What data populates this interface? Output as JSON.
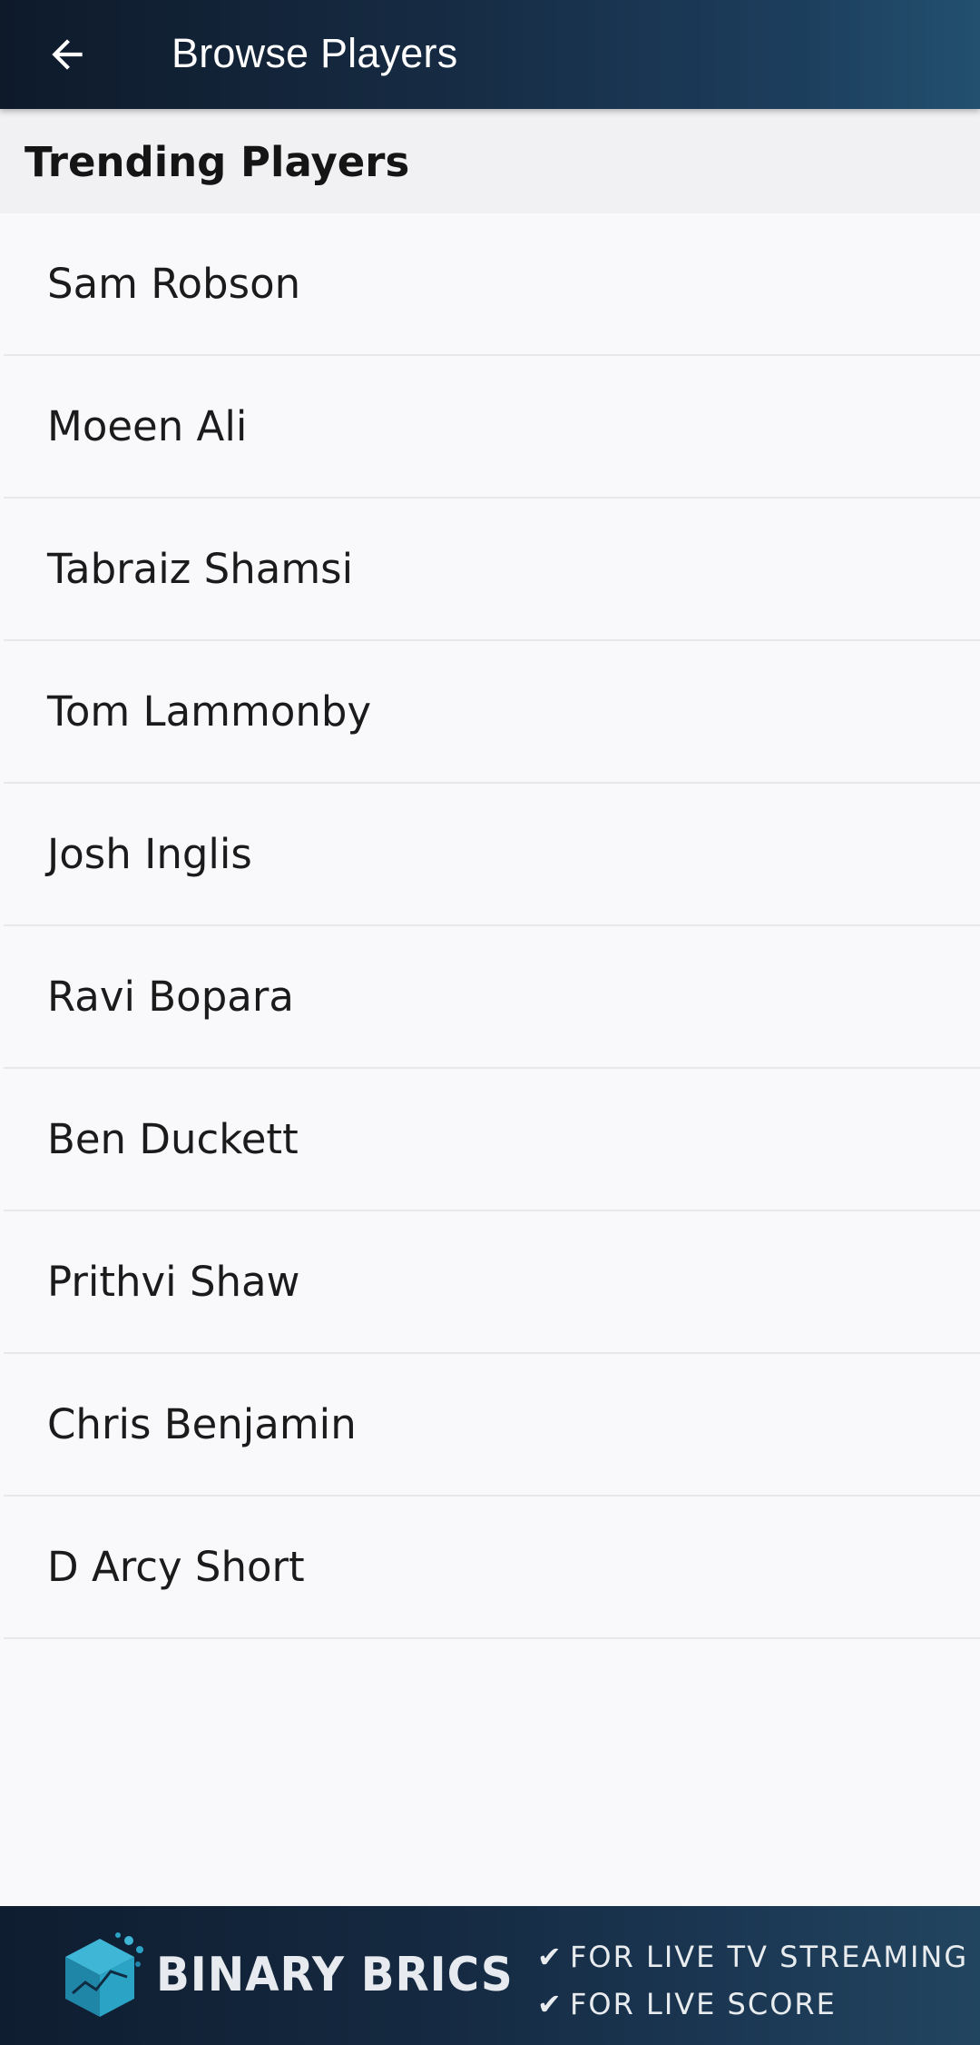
{
  "toolbar": {
    "back_icon": "arrow-left-icon",
    "title": "Browse Players"
  },
  "section": {
    "title": "Trending Players"
  },
  "players": [
    "Sam Robson",
    "Moeen Ali",
    "Tabraiz Shamsi",
    "Tom Lammonby",
    "Josh Inglis",
    "Ravi Bopara",
    "Ben Duckett",
    "Prithvi Shaw",
    "Chris Benjamin",
    "D Arcy Short"
  ],
  "banner": {
    "logo_icon": "binary-brics-cube-logo",
    "brand": "BINARY BRICS",
    "lines": [
      {
        "check": "✔",
        "text": "FOR LIVE TV STREAMING"
      },
      {
        "check": "✔",
        "text": "FOR LIVE SCORE"
      }
    ]
  },
  "colors": {
    "toolbar": "#162b43",
    "background": "#f9f8fb",
    "section_header": "#f1f0f3",
    "divider": "#e8e7ea",
    "banner": "#14283f",
    "logo_accent": "#2aa3c4"
  }
}
